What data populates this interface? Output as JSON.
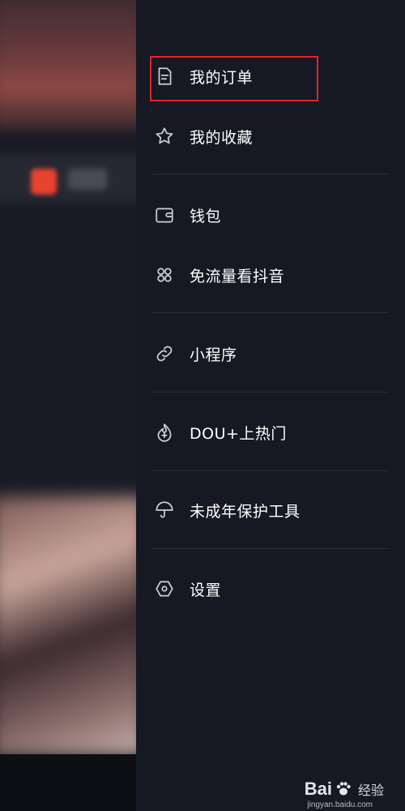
{
  "drawer": {
    "items": [
      {
        "label": "我的订单",
        "icon": "order-icon"
      },
      {
        "label": "我的收藏",
        "icon": "star-icon"
      },
      {
        "label": "钱包",
        "icon": "wallet-icon"
      },
      {
        "label": "免流量看抖音",
        "icon": "grid-icon"
      },
      {
        "label": "小程序",
        "icon": "link-icon"
      },
      {
        "label": "DOU+上热门",
        "icon": "dou-plus-icon"
      },
      {
        "label": "未成年保护工具",
        "icon": "umbrella-icon"
      },
      {
        "label": "设置",
        "icon": "settings-icon"
      }
    ],
    "highlight_color": "#e5232d"
  },
  "watermark": {
    "brand": "Bai",
    "brand2": "经验",
    "url": "jingyan.baidu.com"
  }
}
